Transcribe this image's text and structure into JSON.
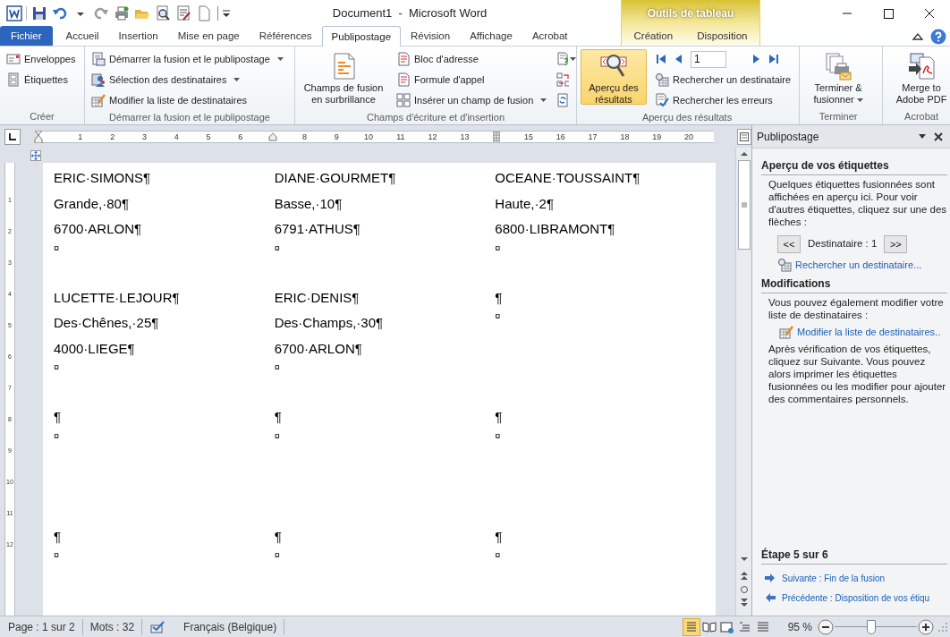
{
  "window": {
    "title": "Document1  -  Microsoft Word",
    "contextual_group": "Outils de tableau"
  },
  "tabs": [
    {
      "label": "Fichier",
      "kind": "file",
      "selected": false
    },
    {
      "label": "Accueil",
      "kind": "normal",
      "selected": false
    },
    {
      "label": "Insertion",
      "kind": "normal",
      "selected": false
    },
    {
      "label": "Mise en page",
      "kind": "normal",
      "selected": false
    },
    {
      "label": "Références",
      "kind": "normal",
      "selected": false
    },
    {
      "label": "Publipostage",
      "kind": "normal",
      "selected": true
    },
    {
      "label": "Révision",
      "kind": "normal",
      "selected": false
    },
    {
      "label": "Affichage",
      "kind": "normal",
      "selected": false
    },
    {
      "label": "Acrobat",
      "kind": "normal",
      "selected": false
    },
    {
      "label": "Création",
      "kind": "contextual",
      "selected": false
    },
    {
      "label": "Disposition",
      "kind": "contextual",
      "selected": false
    }
  ],
  "ribbon": {
    "groups": [
      {
        "label": "Créer",
        "columns": [
          [
            {
              "kind": "small",
              "label": "Enveloppes",
              "dropdown": false
            },
            {
              "kind": "small",
              "label": "Étiquettes",
              "dropdown": false
            }
          ]
        ]
      },
      {
        "label": "Démarrer la fusion et le publipostage",
        "columns": [
          [
            {
              "kind": "small",
              "label": "Démarrer la fusion et le publipostage",
              "dropdown": true
            },
            {
              "kind": "small",
              "label": "Sélection des destinataires",
              "dropdown": true
            },
            {
              "kind": "small",
              "label": "Modifier la liste de destinataires",
              "dropdown": false
            }
          ]
        ]
      },
      {
        "label": "Champs d'écriture et d'insertion",
        "columns": [
          [
            {
              "kind": "large",
              "label": "Champs de fusion en surbrillance",
              "dropdown": false,
              "selected": false
            }
          ],
          [
            {
              "kind": "small",
              "label": "Bloc d'adresse",
              "dropdown": false
            },
            {
              "kind": "small",
              "label": "Formule d'appel",
              "dropdown": false
            },
            {
              "kind": "small",
              "label": "Insérer un champ de fusion",
              "dropdown": true
            }
          ],
          [
            {
              "kind": "icon",
              "dropdown": true
            },
            {
              "kind": "icon",
              "dropdown": false
            },
            {
              "kind": "icon",
              "dropdown": false
            }
          ]
        ]
      },
      {
        "label": "Aperçu des résultats",
        "columns": [
          [
            {
              "kind": "large",
              "label": "Aperçu des résultats",
              "dropdown": false,
              "selected": true
            }
          ],
          [
            {
              "kind": "nav",
              "value": "1"
            },
            {
              "kind": "small",
              "label": "Rechercher un destinataire",
              "dropdown": false
            },
            {
              "kind": "small",
              "label": "Rechercher les erreurs",
              "dropdown": false
            }
          ]
        ]
      },
      {
        "label": "Terminer",
        "columns": [
          [
            {
              "kind": "large",
              "label": "Terminer & fusionner",
              "dropdown": true,
              "selected": false
            }
          ]
        ]
      },
      {
        "label": "Acrobat",
        "columns": [
          [
            {
              "kind": "large",
              "label": "Merge to Adobe PDF",
              "dropdown": false,
              "selected": false
            }
          ]
        ]
      }
    ]
  },
  "ruler": {
    "horizontal": [
      "1",
      "2",
      "3",
      "4",
      "5",
      "6",
      "8",
      "9",
      "10",
      "11",
      "12",
      "13",
      "15",
      "16",
      "17",
      "18",
      "19",
      "20"
    ],
    "vertical": [
      "1",
      "2",
      "3",
      "4",
      "5",
      "6",
      "7",
      "8",
      "9",
      "10",
      "11",
      "12"
    ]
  },
  "document": {
    "rows": [
      [
        {
          "lines": [
            "ERIC·SIMONS¶",
            "Grande,·80¶",
            "6700·ARLON¶"
          ],
          "end_mark": "¤"
        },
        {
          "lines": [
            "DIANE·GOURMET¶",
            "Basse,·10¶",
            "6791·ATHUS¶"
          ],
          "end_mark": "¤"
        },
        {
          "lines": [
            "OCEANE·TOUSSAINT¶",
            "Haute,·2¶",
            "6800·LIBRAMONT¶"
          ],
          "end_mark": "¤"
        }
      ],
      [
        {
          "lines": [
            "LUCETTE·LEJOUR¶",
            "Des·Chênes,·25¶",
            "4000·LIEGE¶"
          ],
          "end_mark": "¤"
        },
        {
          "lines": [
            "ERIC·DENIS¶",
            "Des·Champs,·30¶",
            "6700·ARLON¶"
          ],
          "end_mark": "¤"
        },
        {
          "lines": [
            "¶"
          ],
          "end_mark": "¤"
        }
      ],
      [
        {
          "lines": [
            "¶"
          ],
          "end_mark": "¤"
        },
        {
          "lines": [
            "¶"
          ],
          "end_mark": "¤"
        },
        {
          "lines": [
            "¶"
          ],
          "end_mark": "¤"
        }
      ],
      [
        {
          "lines": [
            "¶"
          ],
          "end_mark": "¤"
        },
        {
          "lines": [
            "¶"
          ],
          "end_mark": "¤"
        },
        {
          "lines": [
            "¶"
          ],
          "end_mark": "¤"
        }
      ]
    ]
  },
  "task_pane": {
    "title": "Publipostage",
    "preview": {
      "heading": "Aperçu de vos étiquettes",
      "text": "Quelques étiquettes fusionnées sont affichées en aperçu ici. Pour voir d'autres étiquettes, cliquez sur une des flèches :",
      "prev_button": "<<",
      "recipient": "Destinataire : 1",
      "next_button": ">>",
      "link": "Rechercher un destinataire..."
    },
    "changes": {
      "heading": "Modifications",
      "text": "Vous pouvez également modifier votre liste de destinataires :",
      "link": "Modifier la liste de destinataires..",
      "after_text": "Après vérification de vos étiquettes, cliquez sur Suivante. Vous pouvez alors imprimer les étiquettes fusionnées ou les modifier pour ajouter des commentaires personnels."
    },
    "step": {
      "heading": "Étape 5 sur 6",
      "links": [
        {
          "kind": "next",
          "label": "Suivante : Fin de la fusion"
        },
        {
          "kind": "previous",
          "label": "Précédente : Disposition de vos étiqu"
        }
      ]
    }
  },
  "status_bar": {
    "page": "Page : 1 sur 2",
    "words": "Mots : 32",
    "language": "Français (Belgique)",
    "views": [
      {
        "selected": true
      },
      {
        "selected": false
      },
      {
        "selected": false
      },
      {
        "selected": false
      },
      {
        "selected": false
      }
    ],
    "zoom": "95 %",
    "zoom_level": {
      "level": 0.45
    }
  }
}
